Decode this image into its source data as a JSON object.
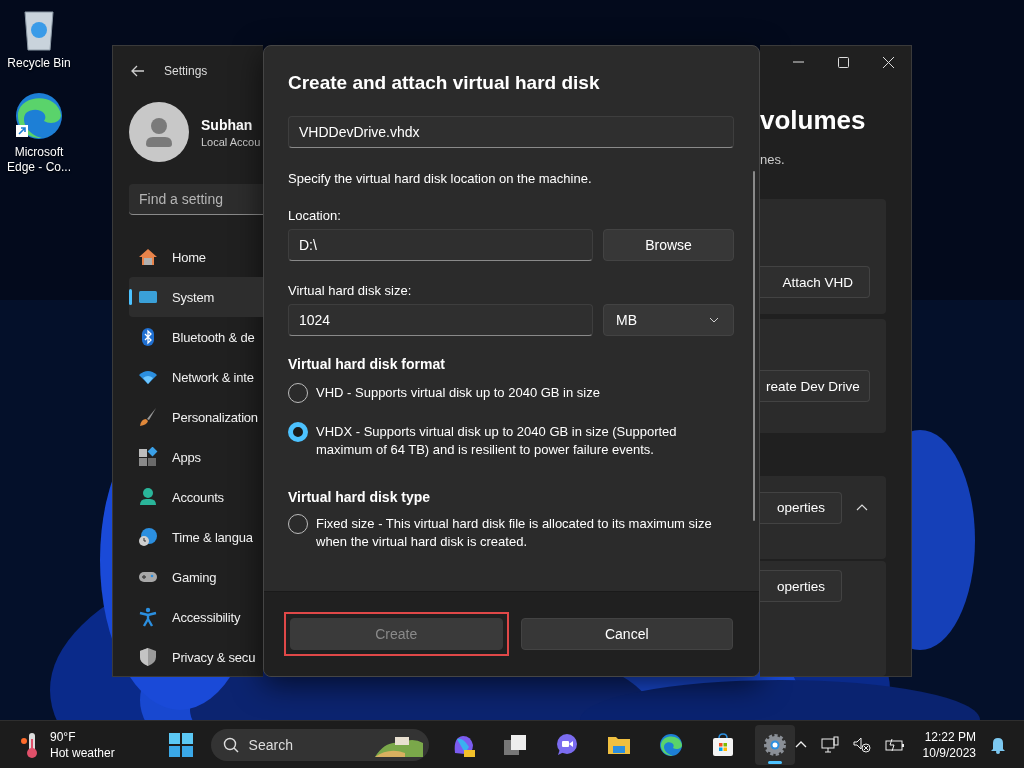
{
  "desktop": {
    "icons": [
      {
        "kind": "recycle",
        "label": "Recycle Bin"
      },
      {
        "kind": "edge",
        "label": "Microsoft Edge - Co..."
      }
    ]
  },
  "settings": {
    "title": "Settings",
    "user": {
      "name": "Subhan",
      "account": "Local Accou"
    },
    "search": {
      "placeholder": "Find a setting"
    },
    "nav": [
      {
        "kind": "home",
        "label": "Home",
        "selected": false
      },
      {
        "kind": "system",
        "label": "System",
        "selected": true
      },
      {
        "kind": "bluetooth",
        "label": "Bluetooth & de",
        "selected": false
      },
      {
        "kind": "network",
        "label": "Network & inte",
        "selected": false
      },
      {
        "kind": "brush",
        "label": "Personalization",
        "selected": false
      },
      {
        "kind": "apps",
        "label": "Apps",
        "selected": false
      },
      {
        "kind": "accounts",
        "label": "Accounts",
        "selected": false
      },
      {
        "kind": "time",
        "label": "Time & langua",
        "selected": false
      },
      {
        "kind": "gaming",
        "label": "Gaming",
        "selected": false
      },
      {
        "kind": "accessibility",
        "label": "Accessibility",
        "selected": false
      },
      {
        "kind": "privacy",
        "label": "Privacy & secu",
        "selected": false
      }
    ],
    "heading": "volumes",
    "subtitle": "nes.",
    "cards": [
      {
        "kind": "plain",
        "button": "Attach VHD"
      },
      {
        "kind": "plain",
        "button": "reate Dev Drive"
      },
      {
        "kind": "expander",
        "button": "operties",
        "expanded": true
      },
      {
        "kind": "plain",
        "button": "operties"
      }
    ]
  },
  "dialog": {
    "title": "Create and attach virtual hard disk",
    "name": {
      "value": "VHDDevDrive.vhdx"
    },
    "hint": "Specify the virtual hard disk location on the machine.",
    "location": {
      "label": "Location:",
      "value": "D:\\",
      "button": "Browse"
    },
    "size": {
      "label": "Virtual hard disk size:",
      "value": "1024",
      "unit": "MB"
    },
    "format": {
      "heading": "Virtual hard disk format",
      "options": [
        {
          "label": "VHD - Supports virtual disk up to 2040 GB in size",
          "selected": false
        },
        {
          "label": "VHDX - Supports virtual disk up to 2040 GB in size (Supported maximum of 64 TB) and is resilient to power failure events.",
          "selected": true
        }
      ]
    },
    "type": {
      "heading": "Virtual hard disk type",
      "options": [
        {
          "label": "Fixed size - This virtual hard disk file is allocated to its maximum size when the virtual hard disk is created.",
          "selected": false
        }
      ]
    },
    "buttons": [
      {
        "label": "Create",
        "disabled": true,
        "highlighted": true
      },
      {
        "label": "Cancel",
        "disabled": false,
        "highlighted": false
      }
    ]
  },
  "taskbar": {
    "weather": {
      "temperature": "90°F",
      "condition": "Hot weather"
    },
    "search": {
      "placeholder": "Search"
    },
    "apps": [
      {
        "kind": "copilot",
        "active": false
      },
      {
        "kind": "taskview",
        "active": false
      },
      {
        "kind": "chat",
        "active": false
      },
      {
        "kind": "folder",
        "active": false
      },
      {
        "kind": "edge",
        "active": false
      },
      {
        "kind": "store",
        "active": false
      },
      {
        "kind": "settings",
        "active": true
      }
    ],
    "time": "12:22 PM",
    "date": "10/9/2023"
  }
}
